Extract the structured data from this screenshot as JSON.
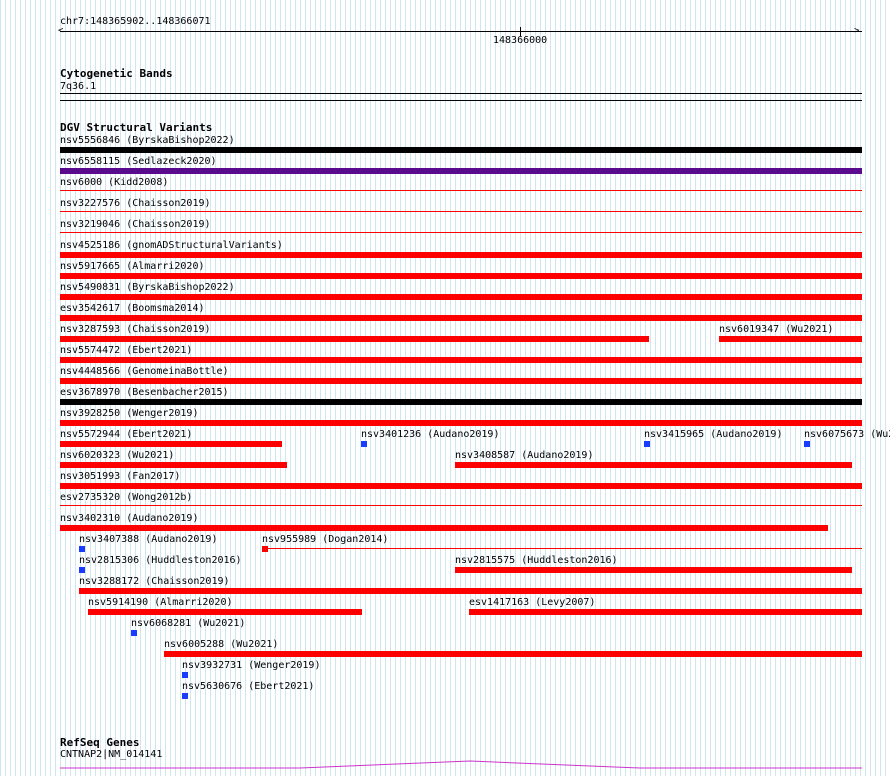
{
  "ruler": {
    "location": "chr7:148365902..148366071",
    "tick_label": "148366000"
  },
  "cytoband": {
    "title": "Cytogenetic Bands",
    "band": "7q36.1"
  },
  "dgv": {
    "title": "DGV Structural Variants",
    "variants": [
      "nsv5556846 (ByrskaBishop2022)",
      "nsv6558115 (Sedlazeck2020)",
      "nsv6000 (Kidd2008)",
      "nsv3227576 (Chaisson2019)",
      "nsv3219046 (Chaisson2019)",
      "nsv4525186 (gnomADStructuralVariants)",
      "nsv5917665 (Almarri2020)",
      "nsv5490831 (ByrskaBishop2022)",
      "esv3542617 (Boomsma2014)",
      "nsv3287593 (Chaisson2019)",
      "nsv6019347 (Wu2021)",
      "nsv5574472 (Ebert2021)",
      "nsv4448566 (GenomeinaBottle)",
      "esv3678970 (Besenbacher2015)",
      "nsv3928250 (Wenger2019)",
      "nsv5572944 (Ebert2021)",
      "nsv3401236 (Audano2019)",
      "nsv3415965 (Audano2019)",
      "nsv6075673 (Wu2",
      "nsv6020323 (Wu2021)",
      "nsv3408587 (Audano2019)",
      "nsv3051993 (Fan2017)",
      "esv2735320 (Wong2012b)",
      "nsv3402310 (Audano2019)",
      "nsv3407388 (Audano2019)",
      "nsv955989 (Dogan2014)",
      "nsv2815306 (Huddleston2016)",
      "nsv2815575 (Huddleston2016)",
      "nsv3288172 (Chaisson2019)",
      "nsv5914190 (Almarri2020)",
      "esv1417163 (Levy2007)",
      "nsv6068281 (Wu2021)",
      "nsv6005288 (Wu2021)",
      "nsv3932731 (Wenger2019)",
      "nsv5630676 (Ebert2021)"
    ]
  },
  "refseq": {
    "title": "RefSeq Genes",
    "gene": "CNTNAP2|NM_014141"
  },
  "colors": {
    "red": "#ff0000",
    "black": "#000000",
    "purple": "#5a0a8c",
    "blue": "#1a3cff",
    "magenta": "#cc33cc",
    "grid": "#cfe6f0"
  }
}
